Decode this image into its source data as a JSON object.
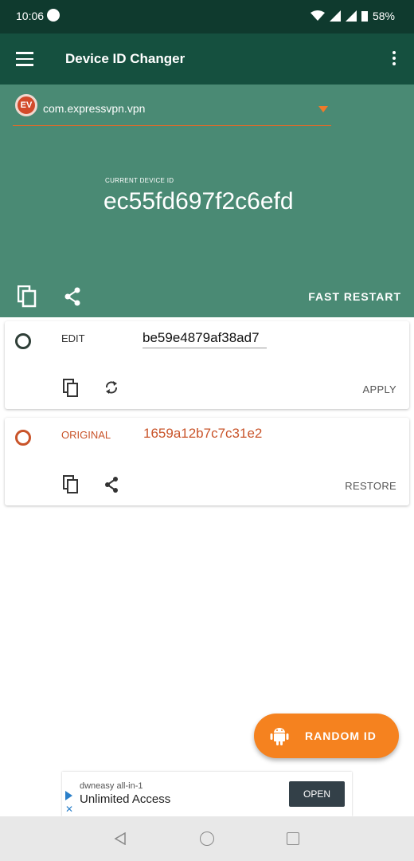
{
  "status": {
    "time": "10:06",
    "battery": "58%",
    "icons": [
      "wifi-icon",
      "signal-icon",
      "battery-icon"
    ]
  },
  "app_bar": {
    "title": "Device ID Changer",
    "icons": [
      "menu-icon",
      "more-vert-icon"
    ]
  },
  "hero": {
    "package": "com.expressvpn.vpn",
    "package_badge": "EV",
    "current_label": "CURRENT DEVICE ID",
    "current_id": "ec55fd697f2c6efd",
    "fast_restart": "FAST RESTART",
    "icons": [
      "copy-icon",
      "share-icon"
    ]
  },
  "edit_card": {
    "label": "EDIT",
    "value": "be59e4879af38ad7",
    "action": "APPLY",
    "icons": [
      "copy-icon",
      "refresh-icon"
    ]
  },
  "original_card": {
    "label": "ORIGINAL",
    "value": "1659a12b7c7c31e2",
    "action": "RESTORE",
    "icons": [
      "copy-icon",
      "share-icon"
    ]
  },
  "fab": {
    "label": "RANDOM ID",
    "icon": "android-icon"
  },
  "ad": {
    "advertiser": "dwneasy all-in-1",
    "headline": "Unlimited Access",
    "cta": "OPEN"
  },
  "colors": {
    "status_bar": "#0f3a2e",
    "app_bar": "#15503f",
    "hero": "#4a8a74",
    "accent": "#f5821f",
    "original": "#c9542a"
  }
}
